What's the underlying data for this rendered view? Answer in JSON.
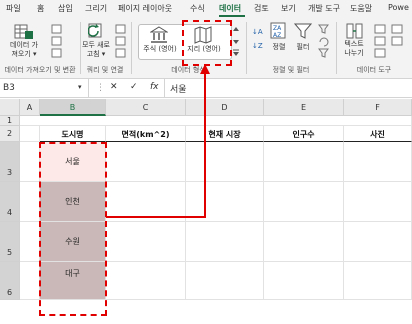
{
  "ribbon_tabs": [
    {
      "label": "파일"
    },
    {
      "label": "홈"
    },
    {
      "label": "삽입"
    },
    {
      "label": "그리기"
    },
    {
      "label": "페이지 레이아웃"
    },
    {
      "label": "수식"
    },
    {
      "label": "데이터"
    },
    {
      "label": "검토"
    },
    {
      "label": "보기"
    },
    {
      "label": "개발 도구"
    },
    {
      "label": "도움말"
    },
    {
      "label": "Powe"
    }
  ],
  "ribbon": {
    "get_data": "데이터 가\n져오기 ▾",
    "refresh_all": "모두 새로\n고침 ▾",
    "stock_type": "주식 (영어)",
    "geo_type": "지리 (영어)",
    "sort": "정렬",
    "filter": "필터",
    "text_to_columns": "텍스트\n나누기",
    "groups": {
      "get_transform": "데이터 가져오기 및 변환",
      "queries": "쿼리 및 연결",
      "data_types": "데이터 형식",
      "sort_filter": "정렬 및 필터",
      "data_tools": "데이터 도구"
    }
  },
  "formula_bar": {
    "name_box": "B3",
    "cancel_glyph": "✕",
    "enter_glyph": "✓",
    "fx_label": "fx",
    "value": "서울"
  },
  "columns": [
    "A",
    "B",
    "C",
    "D",
    "E",
    "F"
  ],
  "rows": [
    "1",
    "2",
    "3",
    "4",
    "5",
    "6"
  ],
  "table_headers": [
    "도시명",
    "면적(km^2)",
    "현재 시장",
    "인구수",
    "사진"
  ],
  "cities": [
    "서울",
    "인천",
    "수원",
    "대구"
  ],
  "colors": {
    "excel_green": "#1e7145",
    "selected_cell": "#fde9e7",
    "range_fill": "#c9b8b7",
    "highlight_red": "#e00000"
  }
}
